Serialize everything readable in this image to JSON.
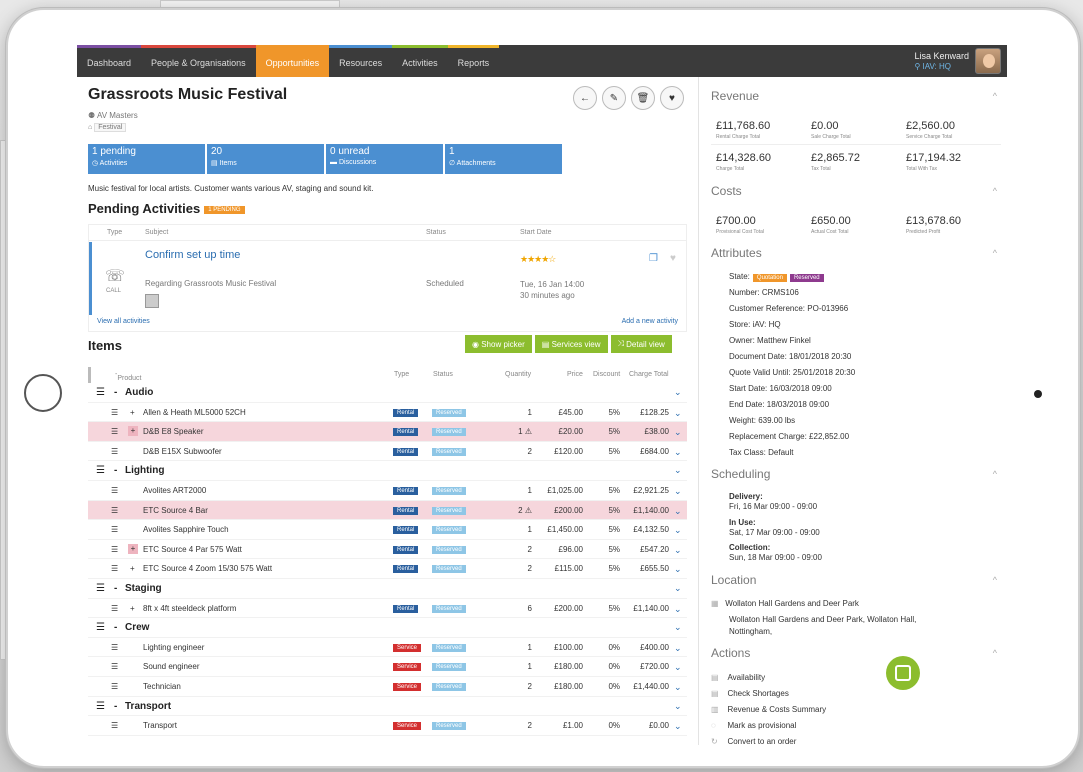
{
  "nav": {
    "items": [
      "Dashboard",
      "People & Organisations",
      "Opportunities",
      "Resources",
      "Activities",
      "Reports"
    ],
    "active": "Opportunities",
    "user_name": "Lisa Kenward",
    "user_org": "IAV: HQ"
  },
  "header": {
    "title": "Grassroots Music Festival",
    "organisation": "AV Masters",
    "tag": "Festival"
  },
  "stats": [
    {
      "value": "1 pending",
      "label": "Activities"
    },
    {
      "value": "20",
      "label": "Items"
    },
    {
      "value": "0 unread",
      "label": "Discussions"
    },
    {
      "value": "1",
      "label": "Attachments"
    }
  ],
  "description": "Music festival for local artists. Customer wants various AV, staging and sound kit.",
  "pending": {
    "heading": "Pending Activities",
    "badge": "1 PENDING",
    "cols": {
      "type": "Type",
      "subject": "Subject",
      "status": "Status",
      "start": "Start Date"
    },
    "activity": {
      "subject": "Confirm set up time",
      "type_label": "CALL",
      "regarding": "Regarding Grassroots Music Festival",
      "status": "Scheduled",
      "stars": "★★★★☆",
      "date": "Tue, 16 Jan 14:00",
      "relative": "30 minutes ago"
    },
    "view_all": "View all activities",
    "add_new": "Add a new activity"
  },
  "items": {
    "heading": "Items",
    "buttons": {
      "show_picker": "Show picker",
      "services_view": "Services view",
      "detail_view": "Detail view"
    },
    "cols": {
      "product": "Product",
      "type": "Type",
      "status": "Status",
      "quantity": "Quantity",
      "price": "Price",
      "discount": "Discount",
      "charge": "Charge Total"
    },
    "rows": [
      {
        "group": "Audio"
      },
      {
        "name": "Allen & Heath ML5000 52CH",
        "type": "Rental",
        "status": "Reserved",
        "qty": "1",
        "price": "£45.00",
        "disc": "5%",
        "total": "£128.25",
        "plus": "+"
      },
      {
        "name": "D&B E8 Speaker",
        "type": "Rental",
        "status": "Reserved",
        "qty": "1 ⚠",
        "price": "£20.00",
        "disc": "5%",
        "total": "£38.00",
        "plus": "+",
        "hl": true,
        "box": true
      },
      {
        "name": "D&B E15X Subwoofer",
        "type": "Rental",
        "status": "Reserved",
        "qty": "2",
        "price": "£120.00",
        "disc": "5%",
        "total": "£684.00"
      },
      {
        "group": "Lighting"
      },
      {
        "name": "Avolites ART2000",
        "type": "Rental",
        "status": "Reserved",
        "qty": "1",
        "price": "£1,025.00",
        "disc": "5%",
        "total": "£2,921.25"
      },
      {
        "name": "ETC Source 4 Bar",
        "type": "Rental",
        "status": "Reserved",
        "qty": "2 ⚠",
        "price": "£200.00",
        "disc": "5%",
        "total": "£1,140.00",
        "hl": true
      },
      {
        "name": "Avolites Sapphire Touch",
        "type": "Rental",
        "status": "Reserved",
        "qty": "1",
        "price": "£1,450.00",
        "disc": "5%",
        "total": "£4,132.50"
      },
      {
        "name": "ETC Source 4 Par 575 Watt",
        "type": "Rental",
        "status": "Reserved",
        "qty": "2",
        "price": "£96.00",
        "disc": "5%",
        "total": "£547.20",
        "plus": "+",
        "box": true
      },
      {
        "name": "ETC Source 4 Zoom 15/30 575 Watt",
        "type": "Rental",
        "status": "Reserved",
        "qty": "2",
        "price": "£115.00",
        "disc": "5%",
        "total": "£655.50",
        "plus": "+"
      },
      {
        "group": "Staging"
      },
      {
        "name": "8ft x 4ft steeldeck platform",
        "type": "Rental",
        "status": "Reserved",
        "qty": "6",
        "price": "£200.00",
        "disc": "5%",
        "total": "£1,140.00",
        "plus": "+"
      },
      {
        "group": "Crew"
      },
      {
        "name": "Lighting engineer",
        "type": "Service",
        "status": "Reserved",
        "qty": "1",
        "price": "£100.00",
        "disc": "0%",
        "total": "£400.00"
      },
      {
        "name": "Sound engineer",
        "type": "Service",
        "status": "Reserved",
        "qty": "1",
        "price": "£180.00",
        "disc": "0%",
        "total": "£720.00"
      },
      {
        "name": "Technician",
        "type": "Service",
        "status": "Reserved",
        "qty": "2",
        "price": "£180.00",
        "disc": "0%",
        "total": "£1,440.00"
      },
      {
        "group": "Transport"
      },
      {
        "name": "Transport",
        "type": "Service",
        "status": "Reserved",
        "qty": "2",
        "price": "£1.00",
        "disc": "0%",
        "total": "£0.00"
      }
    ]
  },
  "revenue": {
    "heading": "Revenue",
    "cards": [
      {
        "value": "£11,768.60",
        "label": "Rental Charge Total"
      },
      {
        "value": "£0.00",
        "label": "Sale Charge Total"
      },
      {
        "value": "£2,560.00",
        "label": "Service Charge Total"
      },
      {
        "value": "£14,328.60",
        "label": "Charge Total"
      },
      {
        "value": "£2,865.72",
        "label": "Tax Total"
      },
      {
        "value": "£17,194.32",
        "label": "Total With Tax"
      }
    ]
  },
  "costs": {
    "heading": "Costs",
    "cards": [
      {
        "value": "£700.00",
        "label": "Provisional Cost Total"
      },
      {
        "value": "£650.00",
        "label": "Actual Cost Total"
      },
      {
        "value": "£13,678.60",
        "label": "Predicted Profit"
      }
    ]
  },
  "attributes": {
    "heading": "Attributes",
    "state_label": "State:",
    "state_pill1": "Quotation",
    "state_pill2": "Reserved",
    "lines": [
      "Number: CRMS106",
      "Customer Reference: PO-013966",
      "Store: iAV: HQ",
      "Owner: Matthew Finkel",
      "Document Date: 18/01/2018 20:30",
      "Quote Valid Until: 25/01/2018 20:30",
      "Start Date: 16/03/2018 09:00",
      "End Date: 18/03/2018 09:00",
      "Weight: 639.00 lbs",
      "Replacement Charge: £22,852.00",
      "Tax Class: Default"
    ]
  },
  "scheduling": {
    "heading": "Scheduling",
    "entries": [
      {
        "label": "Delivery:",
        "value": "Fri, 16 Mar 09:00 - 09:00"
      },
      {
        "label": "In Use:",
        "value": "Sat, 17 Mar 09:00 - 09:00"
      },
      {
        "label": "Collection:",
        "value": "Sun, 18 Mar 09:00 - 09:00"
      }
    ]
  },
  "location": {
    "heading": "Location",
    "name": "Wollaton Hall Gardens and Deer Park",
    "address1": "Wollaton Hall Gardens and Deer Park, Wollaton Hall,",
    "address2": "Nottingham,"
  },
  "actions": {
    "heading": "Actions",
    "items": [
      "Availability",
      "Check Shortages",
      "Revenue & Costs Summary",
      "Mark as provisional",
      "Convert to an order"
    ]
  },
  "colors": {
    "accent": "#f0962a",
    "blue": "#4b8fd1",
    "green": "#8cbd2e",
    "highlight": "#f6d6dc"
  }
}
